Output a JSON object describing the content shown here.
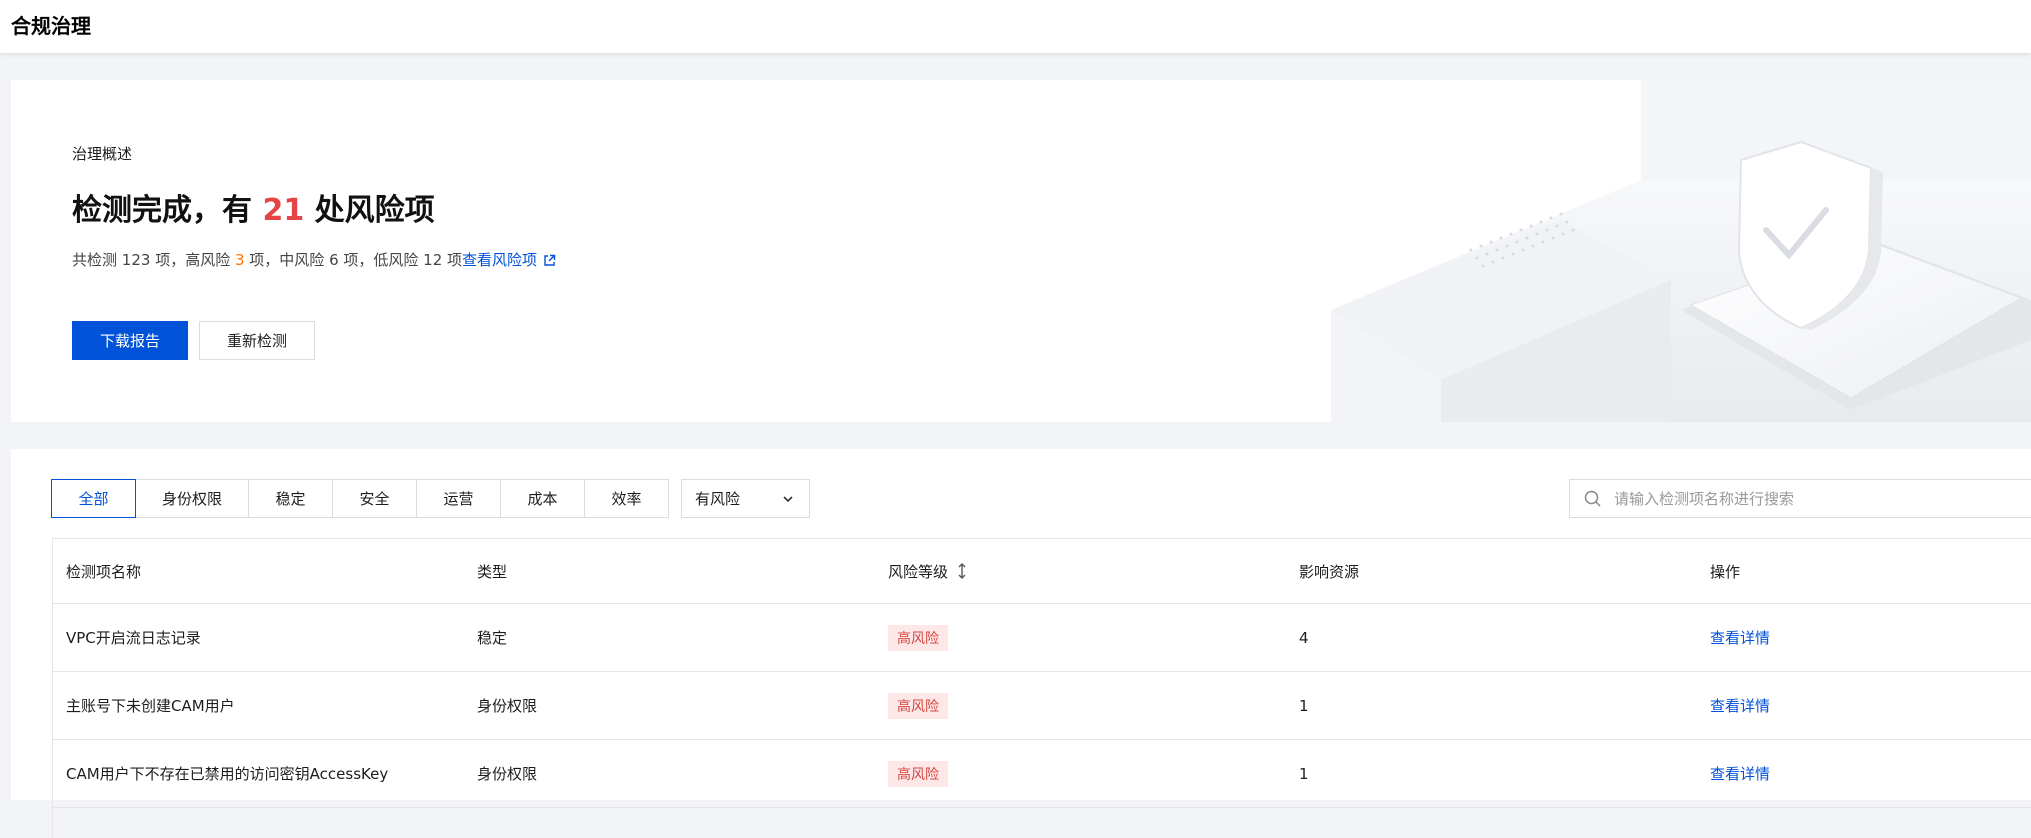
{
  "page": {
    "title": "合规治理"
  },
  "overview": {
    "label": "治理概述",
    "heading_prefix": "检测完成，有 ",
    "heading_count": "21",
    "heading_suffix": " 处风险项",
    "summary_total_prefix": "共检测 ",
    "summary_total": "123",
    "summary_high_prefix": " 项，高风险 ",
    "summary_high": "3",
    "summary_mid_prefix": " 项，中风险 ",
    "summary_mid": "6",
    "summary_low_prefix": " 项，低风险 ",
    "summary_low": "12",
    "summary_low_suffix": " 项",
    "view_risk_link": "查看风险项",
    "download_button": "下载报告",
    "recheck_button": "重新检测"
  },
  "filters": {
    "tabs": [
      "全部",
      "身份权限",
      "稳定",
      "安全",
      "运营",
      "成本",
      "效率"
    ],
    "active_tab": "全部",
    "risk_select": "有风险",
    "search_placeholder": "请输入检测项名称进行搜索"
  },
  "table": {
    "columns": [
      "检测项名称",
      "类型",
      "风险等级",
      "影响资源",
      "操作"
    ],
    "rows": [
      {
        "name": "VPC开启流日志记录",
        "type": "稳定",
        "risk": "高风险",
        "resources": "4",
        "action": "查看详情"
      },
      {
        "name": "主账号下未创建CAM用户",
        "type": "身份权限",
        "risk": "高风险",
        "resources": "1",
        "action": "查看详情"
      },
      {
        "name": "CAM用户下不存在已禁用的访问密钥AccessKey",
        "type": "身份权限",
        "risk": "高风险",
        "resources": "1",
        "action": "查看详情"
      }
    ]
  },
  "colors": {
    "primary": "#0052d9",
    "danger": "#e54545",
    "warning": "#ff7200",
    "risk_badge_bg": "#fde7e7",
    "risk_badge_text": "#d54941"
  },
  "icons": {
    "external_link": "external-link-icon",
    "chevron": "chevron-down-icon",
    "search": "search-icon",
    "sort": "sort-icon",
    "shield": "shield-check-icon"
  }
}
